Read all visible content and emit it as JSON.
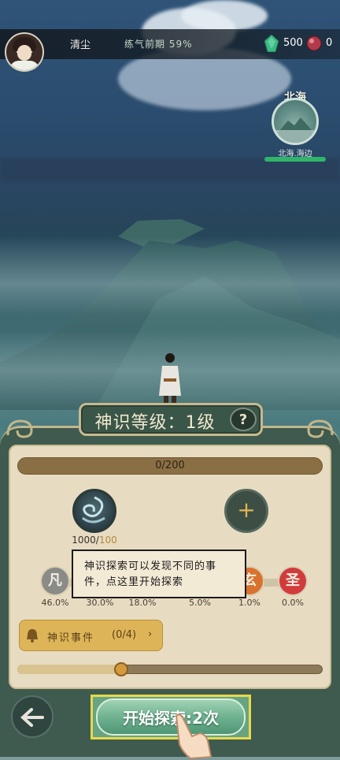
{
  "header": {
    "player_name": "清尘",
    "cultivation_stage": "练气前期 59%",
    "spirit_stones": "500",
    "orb_currency": "0"
  },
  "location": {
    "title": "北海",
    "subtitle": "北海.海边"
  },
  "panel": {
    "title": "神识等级：1级",
    "help_label": "?",
    "progress_text": "0/200",
    "progress_fraction": 0.0,
    "skill_current": "1000",
    "skill_max": "100",
    "add_label": "+",
    "tooltip": "神识探索可以发现不同的事件，点这里开始探索",
    "grades": [
      {
        "label": "凡",
        "pct": "46.0%",
        "color": "#8a8a86"
      },
      {
        "label": "",
        "pct": "30.0%",
        "color": "#4f8f5a"
      },
      {
        "label": "",
        "pct": "18.0%",
        "color": "#3f6fa6"
      },
      {
        "label": "",
        "pct": "5.0%",
        "color": "#8b4fa6"
      },
      {
        "label": "玄",
        "pct": "1.0%",
        "color": "#d9722e"
      },
      {
        "label": "圣",
        "pct": "0.0%",
        "color": "#d23b3b"
      }
    ],
    "event": {
      "label": "神识事件",
      "count": "(0/4)",
      "arrow": "›"
    },
    "slider_fraction": 0.34
  },
  "footer": {
    "back_icon": "arrow-left-icon",
    "start_label": "开始探索:2次"
  },
  "colors": {
    "panel": "#3f5a4e",
    "panel_inner": "#e7dcc2",
    "accent_gold": "#ddb558",
    "start_green": "#6fb291"
  }
}
